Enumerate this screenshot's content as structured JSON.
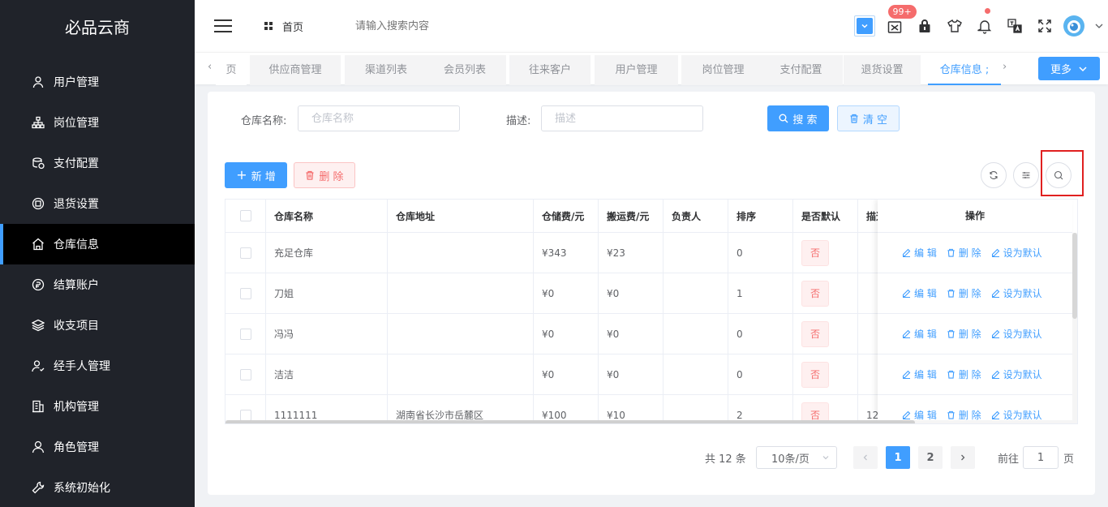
{
  "app": {
    "title": "必品云商"
  },
  "sidebar": {
    "items": [
      {
        "label": "用户管理",
        "icon": "user-icon"
      },
      {
        "label": "岗位管理",
        "icon": "org-chart-icon"
      },
      {
        "label": "支付配置",
        "icon": "coins-icon"
      },
      {
        "label": "退货设置",
        "icon": "return-icon"
      },
      {
        "label": "仓库信息",
        "icon": "warehouse-icon",
        "active": true
      },
      {
        "label": "结算账户",
        "icon": "account-icon"
      },
      {
        "label": "收支项目",
        "icon": "layers-icon"
      },
      {
        "label": "经手人管理",
        "icon": "person-check-icon"
      },
      {
        "label": "机构管理",
        "icon": "building-icon"
      },
      {
        "label": "角色管理",
        "icon": "role-icon"
      },
      {
        "label": "系统初始化",
        "icon": "wrench-icon"
      }
    ]
  },
  "header": {
    "home_label": "首页",
    "search_placeholder": "请输入搜索内容",
    "badge_count": "99+"
  },
  "tabs": {
    "items": [
      {
        "label": "页"
      },
      {
        "label": "供应商管理"
      },
      {
        "label": "渠道列表"
      },
      {
        "label": "会员列表"
      },
      {
        "label": "往来客户"
      },
      {
        "label": "用户管理"
      },
      {
        "label": "岗位管理"
      },
      {
        "label": "支付配置"
      },
      {
        "label": "退货设置"
      },
      {
        "label": "仓库信息 ;"
      }
    ],
    "more_label": "更多"
  },
  "filters": {
    "name_label": "仓库名称:",
    "name_placeholder": "仓库名称",
    "desc_label": "描述:",
    "desc_placeholder": "描述",
    "search_btn": "搜 索",
    "clear_btn": "清 空"
  },
  "toolbar": {
    "add_btn": "新 增",
    "delete_btn": "删 除"
  },
  "table": {
    "columns": [
      "仓库名称",
      "仓库地址",
      "仓储费/元",
      "搬运费/元",
      "负责人",
      "排序",
      "是否默认",
      "描述"
    ],
    "ops_header": "操作",
    "ops": {
      "edit": "编 辑",
      "delete": "删 除",
      "set_default": "设为默认"
    },
    "rows": [
      {
        "name": "充足仓库",
        "address": "",
        "storage_fee": "¥343",
        "handling_fee": "¥23",
        "manager": "",
        "sort": "0",
        "is_default": "否",
        "desc": ""
      },
      {
        "name": "刀姐",
        "address": "",
        "storage_fee": "¥0",
        "handling_fee": "¥0",
        "manager": "",
        "sort": "1",
        "is_default": "否",
        "desc": ""
      },
      {
        "name": "冯冯",
        "address": "",
        "storage_fee": "¥0",
        "handling_fee": "¥0",
        "manager": "",
        "sort": "0",
        "is_default": "否",
        "desc": ""
      },
      {
        "name": "洁洁",
        "address": "",
        "storage_fee": "¥0",
        "handling_fee": "¥0",
        "manager": "",
        "sort": "0",
        "is_default": "否",
        "desc": ""
      },
      {
        "name": "1111111",
        "address": "湖南省长沙市岳麓区",
        "storage_fee": "¥100",
        "handling_fee": "¥10",
        "manager": "",
        "sort": "2",
        "is_default": "否",
        "desc": "12"
      }
    ]
  },
  "pagination": {
    "total": "共 12 条",
    "page_size": "10条/页",
    "pages": [
      "1",
      "2"
    ],
    "current": "1",
    "goto_label": "前往",
    "goto_value": "1",
    "page_suffix": "页"
  },
  "colors": {
    "primary": "#409eff",
    "danger": "#f56c6c",
    "sidebar_bg": "#20232a",
    "highlight": "#e02020"
  }
}
